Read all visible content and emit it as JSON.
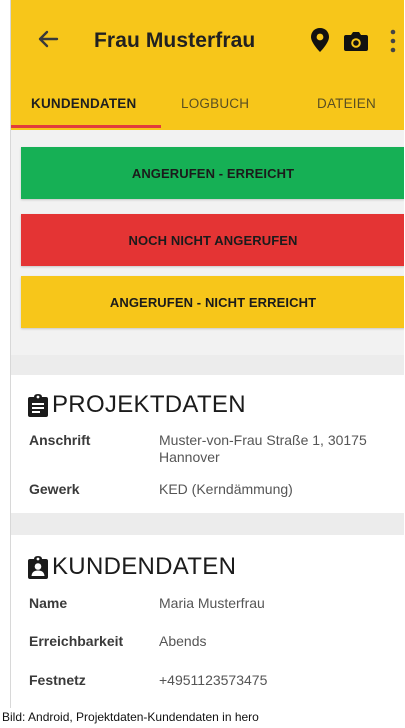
{
  "appbar": {
    "title": "Frau Musterfrau",
    "back_icon": "arrow-left-icon",
    "location_icon": "map-pin-icon",
    "camera_icon": "camera-icon",
    "more_icon": "more-vertical-icon",
    "color": "#f7c61a"
  },
  "tabs": [
    {
      "label": "KUNDENDATEN",
      "active": true
    },
    {
      "label": "LOGBUCH",
      "active": false
    },
    {
      "label": "DATEIEN",
      "active": false
    }
  ],
  "status_buttons": [
    {
      "label": "ANGERUFEN - ERREICHT",
      "color": "#16b055"
    },
    {
      "label": "NOCH NICHT ANGERUFEN",
      "color": "#e43434"
    },
    {
      "label": "ANGERUFEN - NICHT ERREICHT",
      "color": "#f7c61a"
    }
  ],
  "projektdaten": {
    "heading": "PROJEKTDATEN",
    "icon": "clipboard-icon",
    "rows": [
      {
        "label": "Anschrift",
        "value": "Muster-von-Frau Straße 1, 30175",
        "value2": "Hannover"
      },
      {
        "label": "Gewerk",
        "value": "KED (Kerndämmung)"
      }
    ]
  },
  "kundendaten": {
    "heading": "KUNDENDATEN",
    "icon": "contact-card-icon",
    "rows": [
      {
        "label": "Name",
        "value": "Maria Musterfrau"
      },
      {
        "label": "Erreichbarkeit",
        "value": "Abends"
      },
      {
        "label": "Festnetz",
        "value": "+4951123573475"
      }
    ]
  },
  "caption": "Bild: Android, Projektdaten-Kundendaten in hero"
}
